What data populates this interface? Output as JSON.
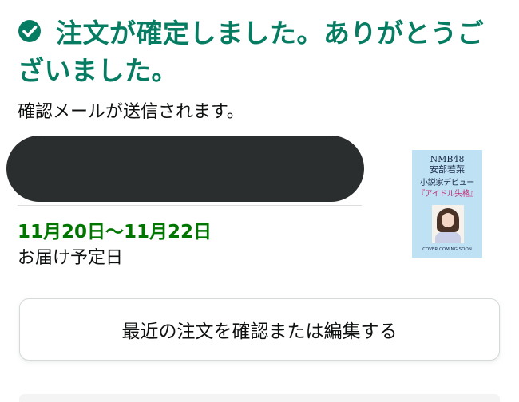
{
  "confirmation": {
    "heading": "注文が確定しました。ありがとうございました。",
    "email_notice": "確認メールが送信されます。",
    "status_color": "#067d62"
  },
  "delivery": {
    "date_range": "11月20日〜11月22日",
    "label": "お届け予定日"
  },
  "product": {
    "cover_line1": "NMB48",
    "cover_line2": "安部若菜",
    "cover_line3": "小説家デビュー",
    "cover_line4": "『アイドル失格』",
    "cover_footer": "COVER COMING SOON"
  },
  "actions": {
    "edit_label": "最近の注文を確認または編集する"
  },
  "icons": {
    "status": "check-circle-icon"
  }
}
